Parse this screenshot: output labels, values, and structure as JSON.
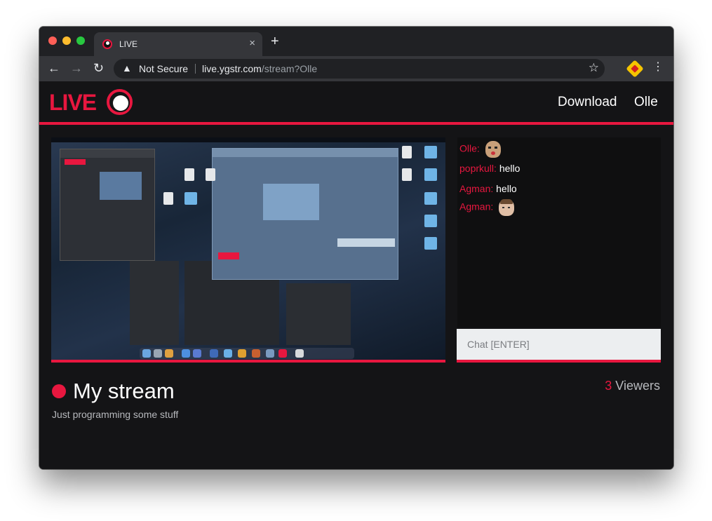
{
  "browser": {
    "tab_title": "LIVE",
    "tab_close": "×",
    "new_tab": "+",
    "security_label": "Not Secure",
    "url_host": "live.ygstr.com",
    "url_path": "/stream?Olle",
    "icons": {
      "back": "arrow-left-icon",
      "forward": "arrow-right-icon",
      "reload": "reload-icon",
      "warning": "warning-icon",
      "star": "star-icon",
      "extension": "extension-icon",
      "menu": "kebab-menu-icon"
    }
  },
  "site": {
    "logo_text": "LIVE",
    "nav": {
      "download": "Download",
      "user": "Olle"
    },
    "accent_color": "#e8173f"
  },
  "chat": {
    "messages": [
      {
        "user": "Olle:",
        "text": "",
        "emote": "kappa-face-emote"
      },
      {
        "user": "poprkull:",
        "text": "hello",
        "emote": ""
      },
      {
        "user": "Agman:",
        "text": "hello",
        "emote": ""
      },
      {
        "user": "Agman:",
        "text": "",
        "emote": "face-emote"
      }
    ],
    "input_placeholder": "Chat [ENTER]"
  },
  "stream": {
    "title": "My stream",
    "description": "Just programming some stuff",
    "viewer_count": "3",
    "viewer_label": "Viewers"
  }
}
